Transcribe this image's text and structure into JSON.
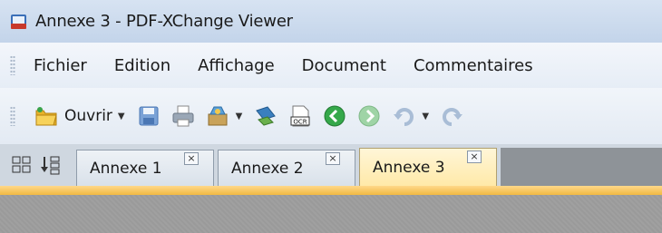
{
  "window": {
    "title": "Annexe 3 - PDF-XChange Viewer",
    "app_icon": "pdf-xchange-icon"
  },
  "menu": {
    "items": [
      {
        "label": "Fichier"
      },
      {
        "label": "Edition"
      },
      {
        "label": "Affichage"
      },
      {
        "label": "Document"
      },
      {
        "label": "Commentaires"
      }
    ]
  },
  "toolbar": {
    "open_label": "Ouvrir",
    "ocr_label": "OCR",
    "icons": [
      "folder-open-icon",
      "save-icon",
      "print-icon",
      "tools-icon",
      "scan-icon",
      "ocr-icon",
      "back-icon",
      "forward-icon",
      "undo-icon",
      "redo-icon"
    ]
  },
  "tabs": {
    "items": [
      {
        "label": "Annexe 1",
        "active": false
      },
      {
        "label": "Annexe 2",
        "active": false
      },
      {
        "label": "Annexe 3",
        "active": true
      }
    ],
    "close_glyph": "×"
  },
  "colors": {
    "active_tab": "#ffe9a8",
    "accent": "#f1b942",
    "doc_background": "#9a9a9a"
  }
}
